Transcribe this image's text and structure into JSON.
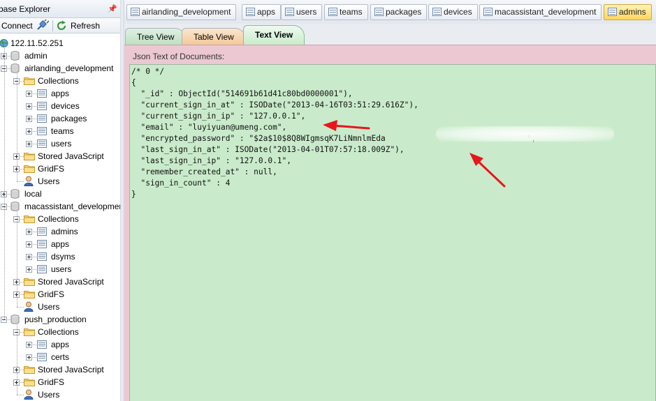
{
  "left_panel": {
    "title": "base Explorer",
    "pin_glyph": "📌",
    "toolbar": {
      "connect_label": "Connect",
      "refresh_label": "Refresh"
    },
    "tree": {
      "server": "122.11.52.251",
      "databases": [
        {
          "name": "admin"
        },
        {
          "name": "airlanding_development",
          "collections_label": "Collections",
          "collections": [
            "apps",
            "devices",
            "packages",
            "teams",
            "users"
          ],
          "stored_js": "Stored JavaScript",
          "gridfs": "GridFS",
          "users": "Users"
        },
        {
          "name": "local"
        },
        {
          "name": "macassistant_development",
          "collections_label": "Collections",
          "collections": [
            "admins",
            "apps",
            "dsyms",
            "users"
          ],
          "stored_js": "Stored JavaScript",
          "gridfs": "GridFS",
          "users": "Users"
        },
        {
          "name": "push_production",
          "collections_label": "Collections",
          "collections": [
            "apps",
            "certs"
          ],
          "stored_js": "Stored JavaScript",
          "gridfs": "GridFS",
          "users": "Users"
        }
      ]
    }
  },
  "tabs": [
    {
      "label": "airlanding_development"
    },
    {
      "label": "apps"
    },
    {
      "label": "users"
    },
    {
      "label": "teams"
    },
    {
      "label": "packages"
    },
    {
      "label": "devices"
    },
    {
      "label": "macassistant_development"
    },
    {
      "label": "admins",
      "active": true
    }
  ],
  "view_tabs": {
    "tree": "Tree View",
    "table": "Table View",
    "text": "Text View"
  },
  "panel_label": "Json Text of Documents:",
  "document_lines": [
    "/* 0 */",
    "{",
    "  \"_id\" : ObjectId(\"514691b61d41c80bd0000001\"),",
    "  \"current_sign_in_at\" : ISODate(\"2013-04-16T03:51:29.616Z\"),",
    "  \"current_sign_in_ip\" : \"127.0.0.1\",",
    "  \"email\" : \"luyiyuan@umeng.com\",",
    "  \"encrypted_password\" : \"$2a$10$8Q8WIgmsqK7LiNmnlmEda                              \",",
    "  \"last_sign_in_at\" : ISODate(\"2013-04-01T07:57:18.009Z\"),",
    "  \"last_sign_in_ip\" : \"127.0.0.1\",",
    "  \"remember_created_at\" : null,",
    "  \"sign_in_count\" : 4",
    "}"
  ],
  "colors": {
    "accent_tab": "#ffd65a",
    "editor_bg": "#c9ebcb",
    "panel_bg": "#ecc8d2",
    "arrow": "#e8161b"
  }
}
